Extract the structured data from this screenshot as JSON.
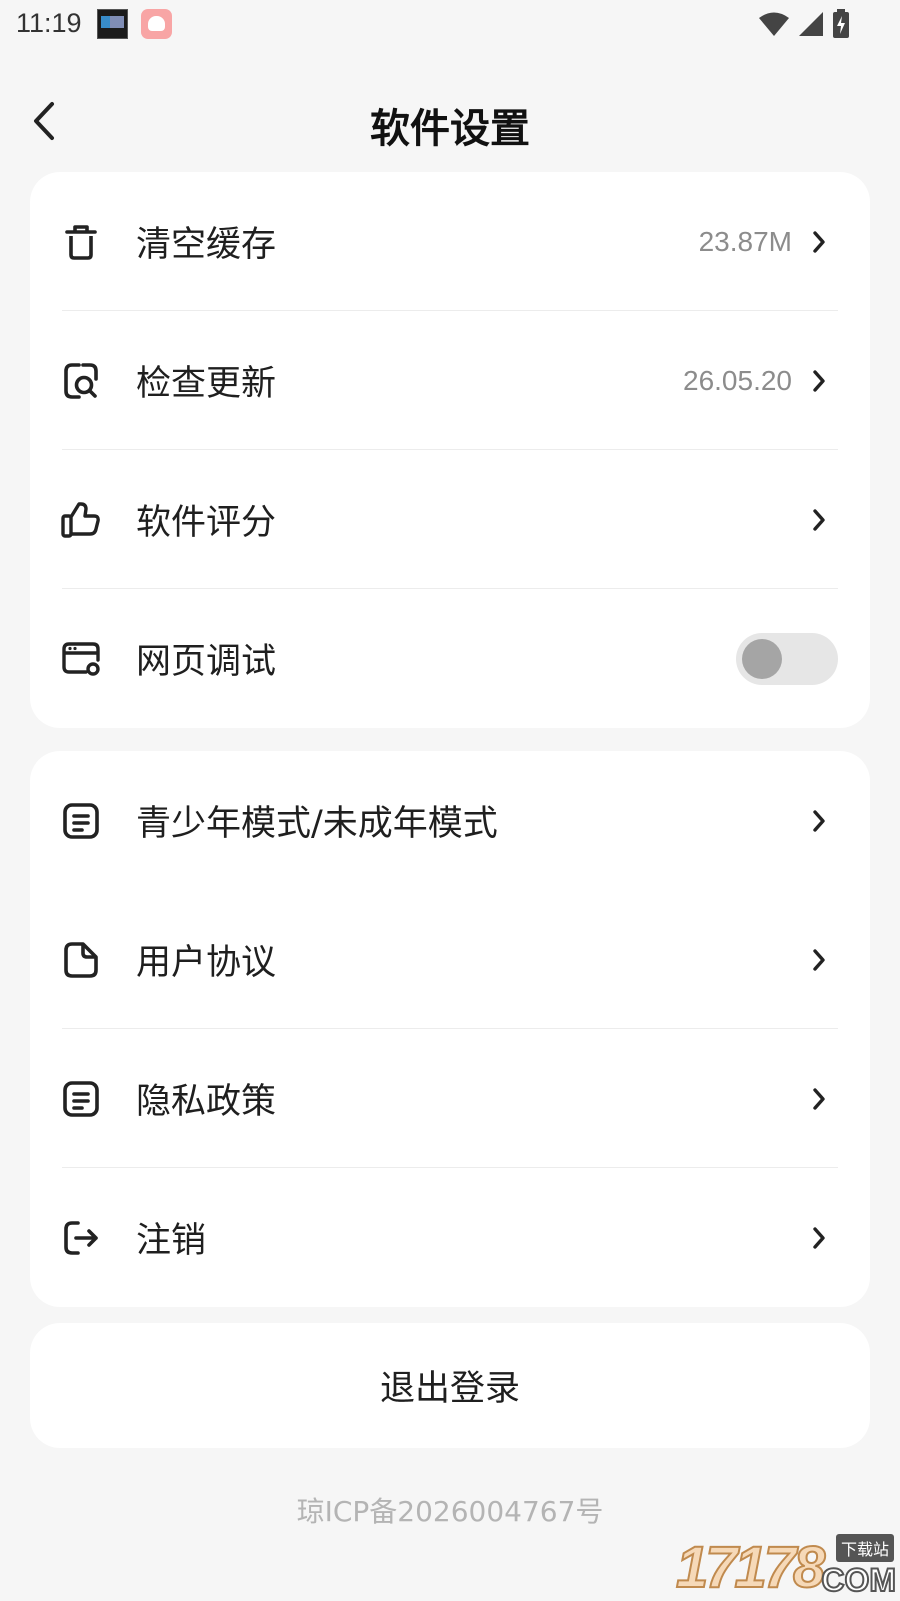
{
  "status_bar": {
    "time": "11:19",
    "icons": [
      "clock-widget-app-icon",
      "rice-app-icon",
      "wifi-icon",
      "cellular-signal-icon",
      "battery-charging-icon"
    ]
  },
  "header": {
    "title": "软件设置",
    "back_icon": "chevron-left-icon"
  },
  "groups": [
    {
      "items": [
        {
          "label": "清空缓存",
          "value": "23.87M",
          "icon": "trash-icon",
          "action": "chevron"
        },
        {
          "label": "检查更新",
          "value": "26.05.20",
          "icon": "search-doc-icon",
          "action": "chevron"
        },
        {
          "label": "软件评分",
          "value": "",
          "icon": "thumbs-up-icon",
          "action": "chevron"
        },
        {
          "label": "网页调试",
          "value": "",
          "icon": "web-debug-icon",
          "action": "toggle",
          "toggle_on": false
        }
      ]
    },
    {
      "items": [
        {
          "label": "青少年模式/未成年模式",
          "icon": "note-icon",
          "action": "chevron"
        },
        {
          "label": "用户协议",
          "icon": "document-icon",
          "action": "chevron"
        },
        {
          "label": "隐私政策",
          "icon": "note-icon",
          "action": "chevron"
        },
        {
          "label": "注销",
          "icon": "logout-icon",
          "action": "chevron"
        }
      ]
    }
  ],
  "logout": {
    "label": "退出登录"
  },
  "footer": {
    "icp": "琼ICP备2026004767号"
  },
  "watermark": {
    "digits": "17178",
    "small": "下载站",
    "com": "COM"
  },
  "colors": {
    "background": "#f6f6f6",
    "card": "#ffffff",
    "text": "#1f1f1f",
    "secondary_text": "#8c8c8c",
    "footer_text": "#b4b4b4",
    "toggle_track": "#e6e6e6",
    "toggle_knob": "#a5a5a5"
  }
}
